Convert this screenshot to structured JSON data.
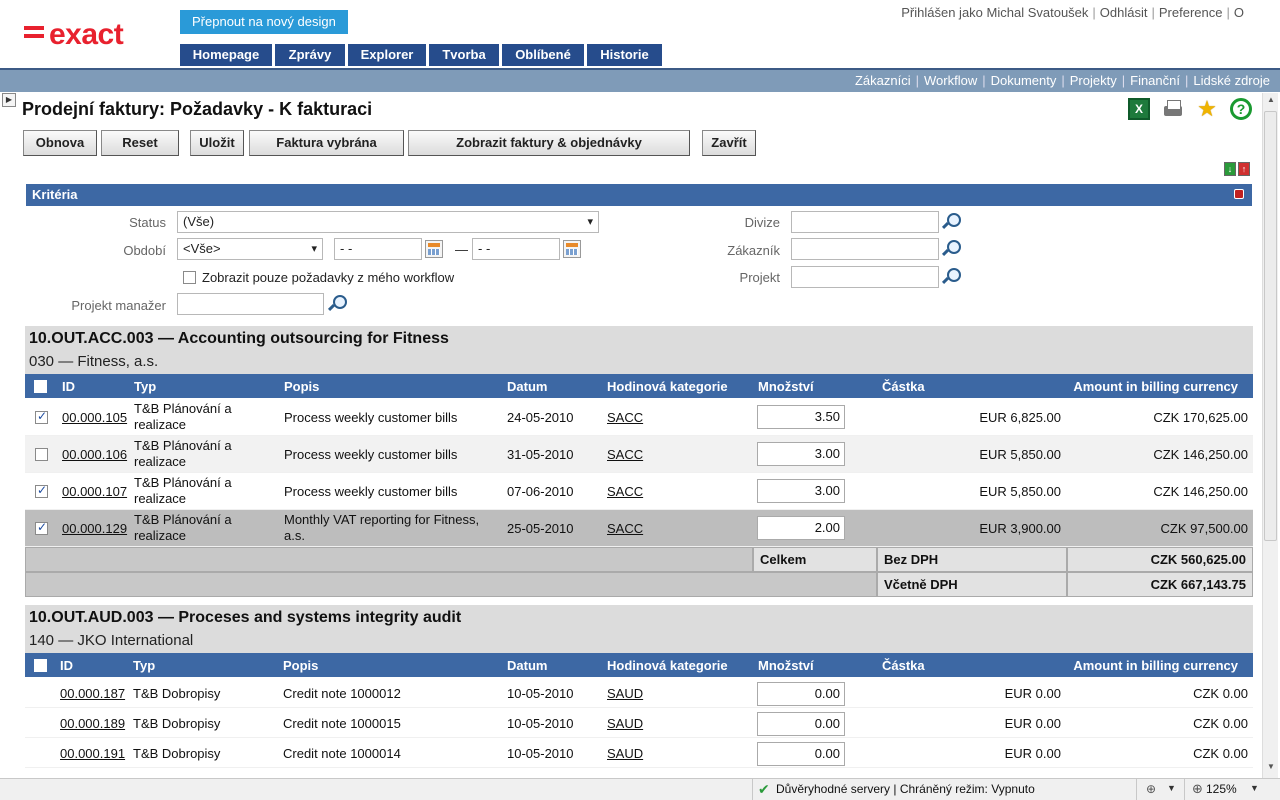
{
  "header": {
    "logo_text": "exact",
    "switch_design": "Přepnout na nový design",
    "nav": [
      "Homepage",
      "Zprávy",
      "Explorer",
      "Tvorba",
      "Oblíbené",
      "Historie"
    ],
    "user_links": [
      "Přihlášen jako Michal Svatoušek",
      "Odhlásit",
      "Preference",
      "O"
    ]
  },
  "subnav": [
    "Zákazníci",
    "Workflow",
    "Dokumenty",
    "Projekty",
    "Finanční",
    "Lidské zdroje"
  ],
  "page": {
    "title": "Prodejní faktury: Požadavky - K fakturaci",
    "excel_label": "X",
    "favorite_label": "★",
    "help_label": "?"
  },
  "actions": [
    "Obnova",
    "Reset",
    "Uložit",
    "Faktura vybrána",
    "Zobrazit faktury & objednávky",
    "Zavřít"
  ],
  "criteria": {
    "title": "Kritéria",
    "status_label": "Status",
    "status_value": "(Vše)",
    "period_label": "Období",
    "period_value": "<Vše>",
    "date_from": "- -",
    "date_dash": "—",
    "date_to": "- -",
    "workflow_only_label": "Zobrazit pouze požadavky z mého workflow",
    "workflow_only_checked": false,
    "manager_label": "Projekt manažer",
    "manager_value": "",
    "division_label": "Divize",
    "customer_label": "Zákazník",
    "project_label": "Projekt"
  },
  "columns": [
    "ID",
    "Typ",
    "Popis",
    "Datum",
    "Hodinová kategorie",
    "Množství",
    "Částka",
    "Amount in billing currency"
  ],
  "projects": [
    {
      "title": "10.OUT.ACC.003 — Accounting outsourcing for Fitness",
      "customer": "030 — Fitness, a.s.",
      "rows": [
        {
          "checked": true,
          "id": "00.000.105",
          "type": "T&B Plánování a realizace",
          "desc": "Process weekly customer bills",
          "date": "24-05-2010",
          "category": "SACC",
          "qty": "3.50",
          "amount": "EUR 6,825.00",
          "billing": "CZK 170,625.00"
        },
        {
          "checked": false,
          "id": "00.000.106",
          "type": "T&B Plánování a realizace",
          "desc": "Process weekly customer bills",
          "date": "31-05-2010",
          "category": "SACC",
          "qty": "3.00",
          "amount": "EUR 5,850.00",
          "billing": "CZK 146,250.00"
        },
        {
          "checked": true,
          "id": "00.000.107",
          "type": "T&B Plánování a realizace",
          "desc": "Process weekly customer bills",
          "date": "07-06-2010",
          "category": "SACC",
          "qty": "3.00",
          "amount": "EUR 5,850.00",
          "billing": "CZK 146,250.00"
        },
        {
          "checked": true,
          "id": "00.000.129",
          "type": "T&B Plánování a realizace",
          "desc": "Monthly VAT reporting for Fitness, a.s.",
          "date": "25-05-2010",
          "category": "SACC",
          "qty": "2.00",
          "amount": "EUR 3,900.00",
          "billing": "CZK 97,500.00"
        }
      ],
      "totals": {
        "label": "Celkem",
        "excl_vat_label": "Bez DPH",
        "excl_vat": "CZK 560,625.00",
        "incl_vat_label": "Včetně DPH",
        "incl_vat": "CZK 667,143.75"
      }
    },
    {
      "title": "10.OUT.AUD.003 — Proceses and systems integrity audit",
      "customer": "140 — JKO International",
      "rows": [
        {
          "id": "00.000.187",
          "type": "T&B Dobropisy",
          "desc": "Credit note 1000012",
          "date": "10-05-2010",
          "category": "SAUD",
          "qty": "0.00",
          "amount": "EUR 0.00",
          "billing": "CZK 0.00"
        },
        {
          "id": "00.000.189",
          "type": "T&B Dobropisy",
          "desc": "Credit note 1000015",
          "date": "10-05-2010",
          "category": "SAUD",
          "qty": "0.00",
          "amount": "EUR 0.00",
          "billing": "CZK 0.00"
        },
        {
          "id": "00.000.191",
          "type": "T&B Dobropisy",
          "desc": "Credit note 1000014",
          "date": "10-05-2010",
          "category": "SAUD",
          "qty": "0.00",
          "amount": "EUR 0.00",
          "billing": "CZK 0.00"
        }
      ]
    }
  ],
  "statusbar": {
    "trust_text": "Důvěryhodné servery | Chráněný režim: Vypnuto",
    "zoom": "125%"
  },
  "colors": {
    "brand_red": "#e8212e",
    "nav_blue": "#264c8c",
    "table_header_blue": "#3d68a4",
    "subnav_blue": "#7f9bb8"
  }
}
